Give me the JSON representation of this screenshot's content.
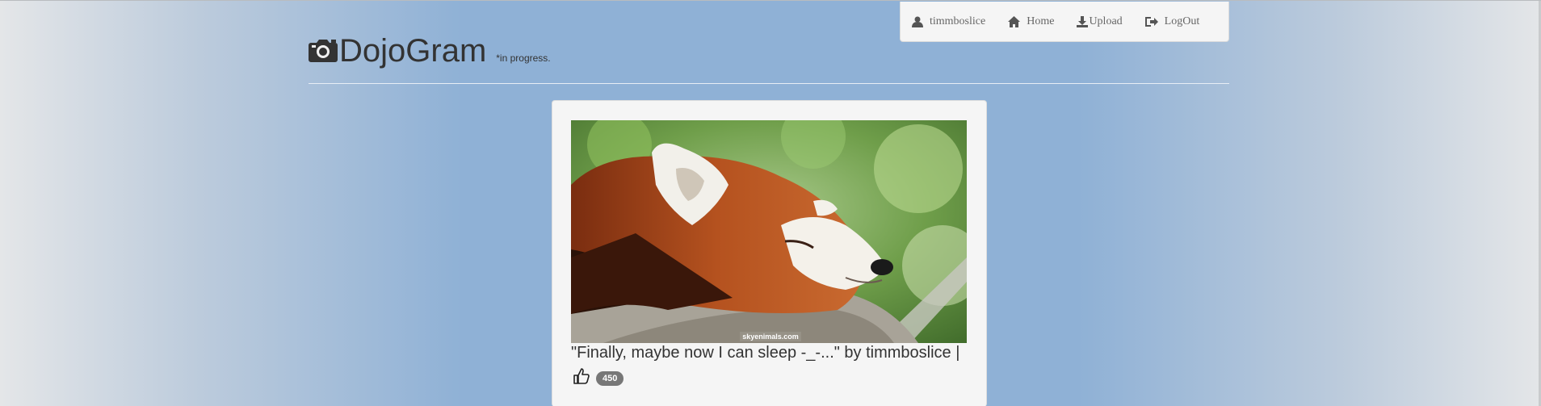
{
  "brand": {
    "title": "DojoGram",
    "tagline": "*in progress."
  },
  "nav": {
    "user": "timmboslice",
    "home": "Home",
    "upload": "Upload",
    "logout": "LogOut"
  },
  "post": {
    "image_watermark": "skyenimals.com",
    "caption": "\"Finally, maybe now I can sleep -_-...\" by timmboslice |",
    "likes": "450"
  },
  "colors": {
    "background": "#8fb1d6",
    "panel": "#f5f5f5",
    "badge": "#777777"
  }
}
